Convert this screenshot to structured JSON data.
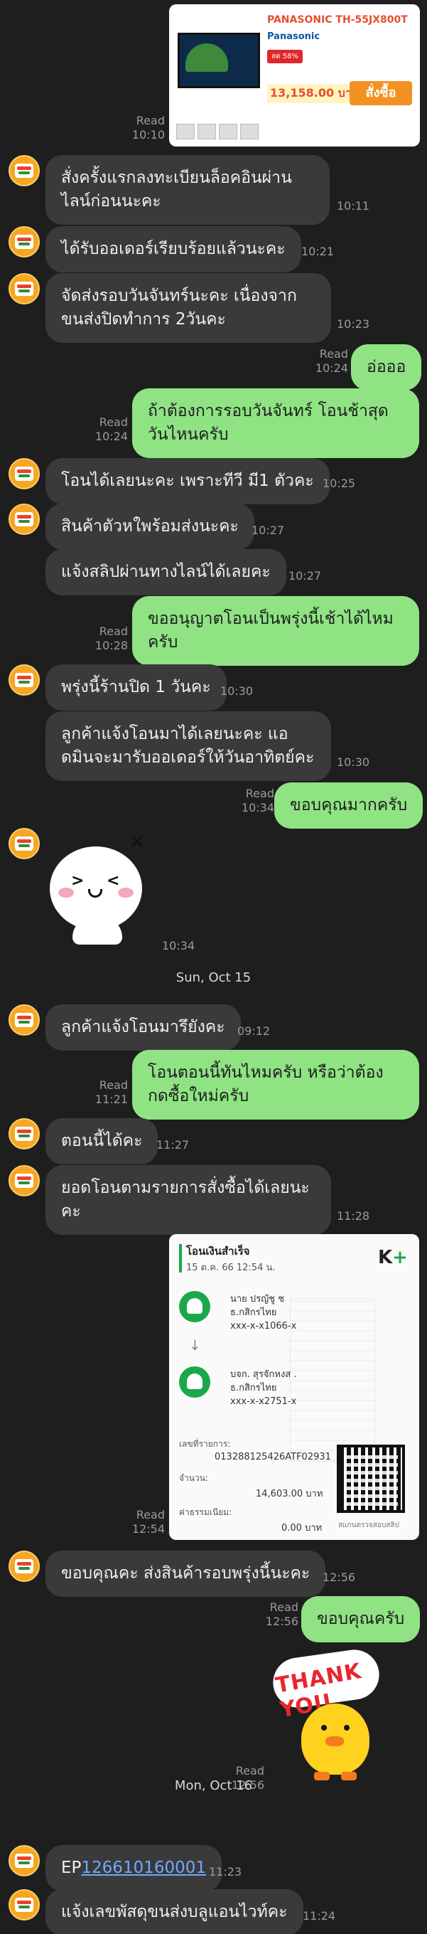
{
  "product_card": {
    "title": "PANASONIC TH-55JX800T",
    "brand": "Panasonic",
    "discount": "ลด 58%",
    "price": "13,158.00 บาท",
    "buy_label": "สั่งซื้อ"
  },
  "messages": {
    "m0": {
      "read": "Read",
      "time": "10:10"
    },
    "m1": {
      "text": "สั่งครั้งแรกลงทะเบียนล็อคอินผ่านไลน์ก่อนนะคะ",
      "time": "10:11"
    },
    "m2": {
      "text": "ได้รับออเดอร์เรียบร้อยแล้วนะคะ",
      "time": "10:21"
    },
    "m3": {
      "text": "จัดส่งรอบวันจันทร์นะคะ เนื่องจากขนส่งปิดทำการ 2วันคะ",
      "time": "10:23"
    },
    "m4": {
      "text": "อ่อออ",
      "read": "Read",
      "time": "10:24"
    },
    "m5": {
      "text": "ถ้าต้องการรอบวันจันทร์ โอนช้าสุดวันไหนครับ",
      "read": "Read",
      "time": "10:24"
    },
    "m6": {
      "text": "โอนได้เลยนะคะ เพราะทีวี มี1 ตัวคะ",
      "time": "10:25"
    },
    "m7": {
      "text": "สินค้าตัวหใพร้อมส่งนะคะ",
      "time": "10:27"
    },
    "m8": {
      "text": "แจ้งสลิปผ่านทางไลน์ได้เลยคะ",
      "time": "10:27"
    },
    "m9": {
      "text": "ขออนุญาตโอนเป็นพรุ่งนี้เช้าได้ไหมครับ",
      "read": "Read",
      "time": "10:28"
    },
    "m10": {
      "text": "พรุ่งนี้ร้านปิด 1 วันคะ",
      "time": "10:30"
    },
    "m11": {
      "text": "ลูกค้าแจ้งโอนมาได้เลยนะคะ แอดมินจะมารับออเดอร์ให้วันอาทิตย์คะ",
      "time": "10:30"
    },
    "m12": {
      "text": "ขอบคุณมากครับ",
      "read": "Read",
      "time": "10:34"
    },
    "m13": {
      "time": "10:34"
    },
    "m14": {
      "text": "ลูกค้าแจ้งโอนมารึยังคะ",
      "time": "09:12"
    },
    "m15": {
      "text": "โอนตอนนี้ทันไหมครับ หรือว่าต้องกดซื้อใหม่ครับ",
      "read": "Read",
      "time": "11:21"
    },
    "m16": {
      "text": "ตอนนี้ได้คะ",
      "time": "11:27"
    },
    "m17": {
      "text": "ยอดโอนตามรายการสั่งซื้อได้เลยนะคะ",
      "time": "11:28"
    },
    "m18": {
      "read": "Read",
      "time": "12:54"
    },
    "m19": {
      "text": "ขอบคุณคะ ส่งสินค้ารอบพรุ่งนี้นะคะ",
      "time": "12:56"
    },
    "m20": {
      "text": "ขอบคุณครับ",
      "read": "Read",
      "time": "12:56"
    },
    "m21": {
      "read": "Read",
      "time": "12:56"
    },
    "m22": {
      "prefix": "EP",
      "link": "126610160001",
      "time": "11:23"
    },
    "m23": {
      "text": "แจ้งเลขพัสดุขนส่งบลูแอนไวท์คะ",
      "time": "11:24"
    }
  },
  "date_separators": {
    "d1": "Sun, Oct 15",
    "d2": "Mon, Oct 16"
  },
  "slip": {
    "title": "โอนเงินสำเร็จ",
    "datetime": "15 ต.ค. 66  12:54 น.",
    "brand": "K+",
    "from_name": "นาย ปรญัชู ช",
    "from_bank": "ธ.กสิกรไทย",
    "from_acct": "xxx-x-x1066-x",
    "to_name": "บจก. สุรจักหงส .",
    "to_bank": "ธ.กสิกรไทย",
    "to_acct": "xxx-x-x2751-x",
    "ref_label": "เลขที่รายการ:",
    "ref_value": "013288125426ATF02931",
    "amount_label": "จำนวน:",
    "amount_value": "14,603.00 บาท",
    "fee_label": "ค่าธรรมเนียม:",
    "fee_value": "0.00 บาท",
    "qr_note": "สแกนตรวจสอบสลิป"
  },
  "sticker_thank_you_text": "THANK YOU",
  "colors": {
    "background": "#1e1e1e",
    "incoming_bubble": "#3a3a3a",
    "outgoing_bubble": "#8fe383",
    "link": "#6fa8ff"
  }
}
